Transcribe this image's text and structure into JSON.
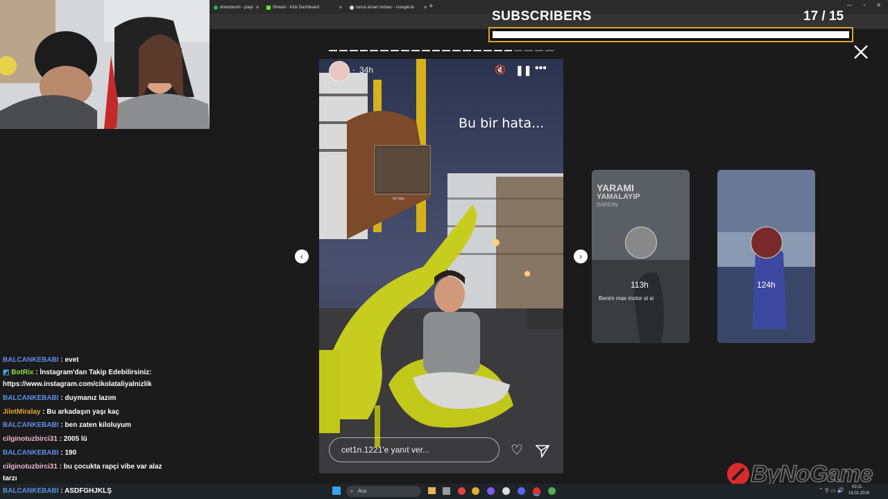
{
  "browser": {
    "tabs": [
      {
        "label": "dolubduum - playlist by",
        "icon": "spotify-icon"
      },
      {
        "label": "Stream - Kick Dashboard",
        "icon": "kick-icon"
      },
      {
        "label": "tunca arslan torbacı - Google'da",
        "icon": "google-icon"
      }
    ],
    "new_tab_symbol": "+"
  },
  "overlay": {
    "subscribers_title": "SUBSCRIBERS",
    "subscribers_count": "17 / 15",
    "subscribers_progress": 1.0,
    "accent_color": "#e5a32b",
    "watermark": "ByNoGame"
  },
  "story": {
    "time_ago": "34h",
    "caption": "Bu bir hata...",
    "reply_placeholder": "cet1n.1221'e yanıt ver...",
    "segments_total": 22,
    "segments_viewed": 18,
    "mini_post_label": "bir hata"
  },
  "side_stories": [
    {
      "time_ago": "113h",
      "overlay_title": "YARAMI",
      "overlay_sub": "YAMALAYIP",
      "overlay_sub2": "SARDIN",
      "caption": "Benim max motor st si"
    },
    {
      "time_ago": "124h"
    }
  ],
  "chat": {
    "messages": [
      {
        "user": "BALCANKEBABI",
        "text": ": evet",
        "color": "blue"
      },
      {
        "user": "BotRix",
        "text": ": İnstagram'dan Takip Edebilirsiniz:",
        "text2": "https://www.instagram.com/cikolataliyalnizlik",
        "color": "green"
      },
      {
        "user": "BALCANKEBABI",
        "text": ": duymanız lazım",
        "color": "blue"
      },
      {
        "user": "JiletMiralay",
        "text": ": Bu arkadaşın yaşı kaç",
        "color": "gold"
      },
      {
        "user": "BALCANKEBABI",
        "text": ": ben zaten kiloluyum",
        "color": "blue"
      },
      {
        "user": "cilginotuzbirci31",
        "text": ": 2005 lü",
        "color": "pink"
      },
      {
        "user": "BALCANKEBABI",
        "text": ": 190",
        "color": "blue"
      },
      {
        "user": "cilginotuzbirci31",
        "text": ": bu çocukta rapçi vibe var alaz",
        "text2": "tarzı",
        "color": "pink"
      },
      {
        "user": "BALCANKEBABI",
        "text": ": ASDFGHJKLŞ",
        "color": "blue"
      }
    ]
  },
  "taskbar": {
    "search_placeholder": "Ara",
    "time": "03:11",
    "date": "18.02.2026"
  }
}
